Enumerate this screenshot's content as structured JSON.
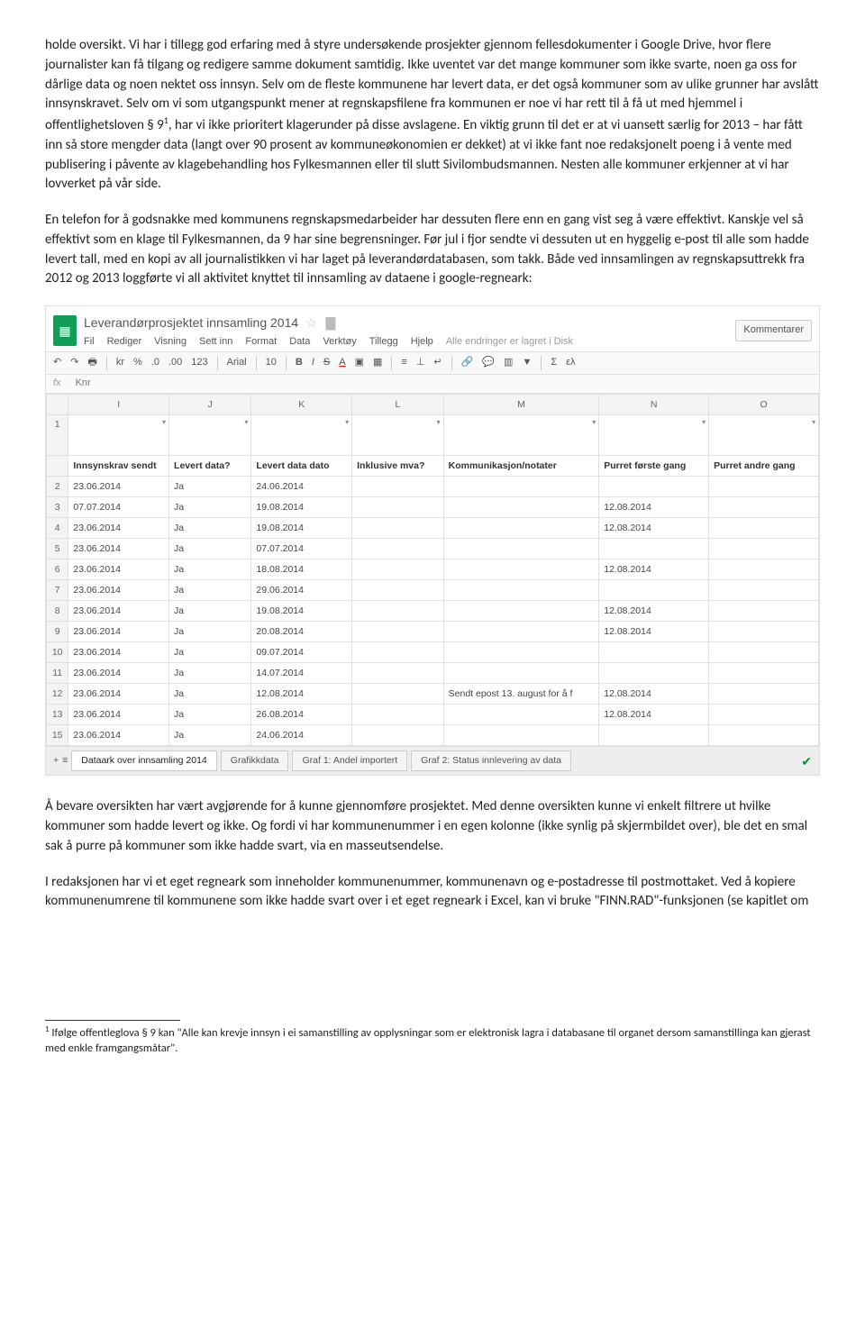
{
  "para1": "holde oversikt. Vi har i tillegg god erfaring med å styre undersøkende prosjekter gjennom fellesdokumenter i Google Drive, hvor flere journalister kan få tilgang og redigere samme dokument samtidig. Ikke uventet var det mange kommuner som ikke svarte, noen ga oss for dårlige data og noen nektet oss innsyn. Selv om de fleste kommunene har levert data, er det også kommuner som av ulike grunner har avslått innsynskravet. Selv om vi som utgangspunkt mener at regnskapsfilene fra kommunen er noe vi har rett til å få ut med hjemmel i offentlighetsloven § 9",
  "para1b": ", har vi ikke prioritert klagerunder på disse avslagene. En viktig grunn til det er at vi uansett særlig for 2013 – har fått inn så store mengder data (langt over 90 prosent av kommuneøkonomien er dekket) at vi ikke fant noe redaksjonelt poeng i å vente med publisering i påvente av klagebehandling hos Fylkesmannen eller til slutt Sivilombudsmannen. Nesten alle kommuner erkjenner at vi har lovverket på vår side.",
  "para2": "En telefon for å godsnakke med kommunens regnskapsmedarbeider har dessuten flere enn en gang vist seg å være effektivt. Kanskje vel så effektivt som en klage til Fylkesmannen, da 9 har sine begrensninger. Før jul i fjor sendte vi dessuten ut en hyggelig e-post til alle som hadde levert tall, med en kopi av all journalistikken vi har laget på leverandørdatabasen, som takk. Både ved innsamlingen av regnskapsuttrekk fra 2012 og 2013 loggførte vi all aktivitet knyttet til innsamling av dataene i google-regneark:",
  "para3": "Å bevare oversikten har vært avgjørende for å kunne gjennomføre prosjektet. Med denne oversikten kunne vi enkelt filtrere ut hvilke kommuner som hadde levert og ikke. Og fordi vi har kommunenummer i en egen kolonne (ikke synlig på skjermbildet over), ble det en smal sak å purre på kommuner som ikke hadde svart, via en masseutsendelse.",
  "para4": "I redaksjonen har vi et eget regneark som inneholder kommunenummer, kommunenavn og e-postadresse til postmottaket. Ved å kopiere kommunenumrene til kommunene som ikke hadde svart over i et eget regneark i Excel, kan vi bruke \"FINN.RAD\"-funksjonen (se kapitlet om",
  "footnote_ref": "1",
  "footnote": " Ifølge offentleglova § 9 kan \"Alle kan krevje innsyn i ei samanstilling av opplysningar som er elektronisk lagra i databasane til organet dersom samanstillinga kan gjerast med enkle framgangsmåtar\".",
  "sheets": {
    "title": "Leverandørprosjektet innsamling 2014",
    "star": "☆",
    "menubar": {
      "fil": "Fil",
      "rediger": "Rediger",
      "visning": "Visning",
      "settinn": "Sett inn",
      "format": "Format",
      "data": "Data",
      "verktoy": "Verktøy",
      "tillegg": "Tillegg",
      "hjelp": "Hjelp",
      "disk": "Alle endringer er lagret i Disk"
    },
    "comment_btn": "Kommentarer",
    "toolbar": {
      "kr": "kr",
      "pct": "%",
      "dec1": ".0",
      "dec2": ".00",
      "num": "123",
      "font": "Arial",
      "size": "10",
      "bold": "B",
      "italic": "I",
      "strike": "S",
      "under": "A",
      "sigma": "Σ",
      "more": "ελ"
    },
    "fx_label": "fx",
    "fx_value": "Knr",
    "cols": [
      "I",
      "J",
      "K",
      "L",
      "M",
      "N",
      "O"
    ],
    "headers": [
      "Innsynskrav sendt",
      "Levert data?",
      "Levert data dato",
      "Inklusive mva?",
      "Kommunikasjon/notater",
      "Purret første gang",
      "Purret andre gang"
    ],
    "rows": [
      {
        "n": "2",
        "c": [
          "23.06.2014",
          "Ja",
          "24.06.2014",
          "",
          "",
          "",
          ""
        ]
      },
      {
        "n": "3",
        "c": [
          "07.07.2014",
          "Ja",
          "19.08.2014",
          "",
          "",
          "12.08.2014",
          ""
        ]
      },
      {
        "n": "4",
        "c": [
          "23.06.2014",
          "Ja",
          "19.08.2014",
          "",
          "",
          "12.08.2014",
          ""
        ]
      },
      {
        "n": "5",
        "c": [
          "23.06.2014",
          "Ja",
          "07.07.2014",
          "",
          "",
          "",
          ""
        ]
      },
      {
        "n": "6",
        "c": [
          "23.06.2014",
          "Ja",
          "18.08.2014",
          "",
          "",
          "12.08.2014",
          ""
        ]
      },
      {
        "n": "7",
        "c": [
          "23.06.2014",
          "Ja",
          "29.06.2014",
          "",
          "",
          "",
          ""
        ]
      },
      {
        "n": "8",
        "c": [
          "23.06.2014",
          "Ja",
          "19.08.2014",
          "",
          "",
          "12.08.2014",
          ""
        ]
      },
      {
        "n": "9",
        "c": [
          "23.06.2014",
          "Ja",
          "20.08.2014",
          "",
          "",
          "12.08.2014",
          ""
        ]
      },
      {
        "n": "10",
        "c": [
          "23.06.2014",
          "Ja",
          "09.07.2014",
          "",
          "",
          "",
          ""
        ]
      },
      {
        "n": "11",
        "c": [
          "23.06.2014",
          "Ja",
          "14.07.2014",
          "",
          "",
          "",
          ""
        ]
      },
      {
        "n": "12",
        "c": [
          "23.06.2014",
          "Ja",
          "12.08.2014",
          "",
          "Sendt epost 13. august for å f",
          "12.08.2014",
          ""
        ]
      },
      {
        "n": "13",
        "c": [
          "23.06.2014",
          "Ja",
          "26.08.2014",
          "",
          "",
          "12.08.2014",
          ""
        ]
      },
      {
        "n": "15",
        "c": [
          "23.06.2014",
          "Ja",
          "24.06.2014",
          "",
          "",
          "",
          ""
        ]
      }
    ],
    "tabs": {
      "t1": "Dataark over innsamling 2014",
      "t2": "Grafikkdata",
      "t3": "Graf 1: Andel importert",
      "t4": "Graf 2: Status innlevering av data"
    }
  }
}
